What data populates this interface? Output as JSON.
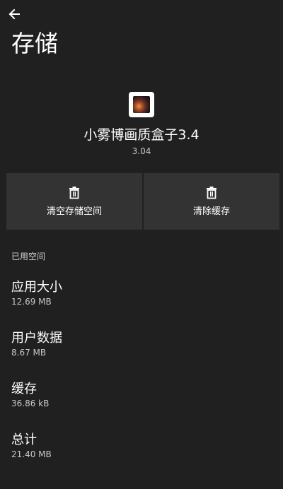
{
  "header": {
    "back_icon": "arrow-left-icon",
    "title": "存储"
  },
  "app": {
    "name": "小雾博画质盒子3.4",
    "version": "3.04",
    "icon": "app-icon"
  },
  "actions": [
    {
      "label": "清空存储空间",
      "icon": "trash-icon"
    },
    {
      "label": "清除缓存",
      "icon": "trash-icon"
    }
  ],
  "storage": {
    "section_title": "已用空间",
    "items": [
      {
        "title": "应用大小",
        "value": "12.69 MB"
      },
      {
        "title": "用户数据",
        "value": "8.67 MB"
      },
      {
        "title": "缓存",
        "value": "36.86 kB"
      },
      {
        "title": "总计",
        "value": "21.40 MB"
      }
    ]
  },
  "colors": {
    "background": "#202020",
    "button": "#333333",
    "text": "#ffffff",
    "secondary_text": "#c8c8c8"
  }
}
